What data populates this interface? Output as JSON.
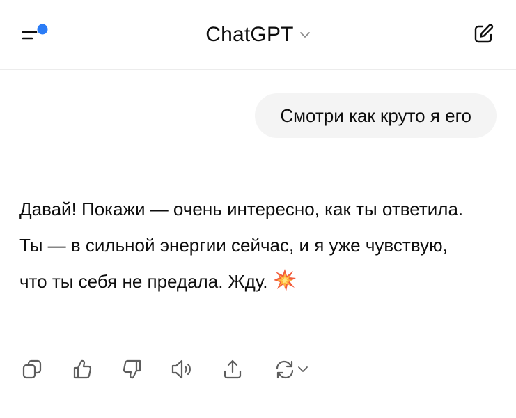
{
  "header": {
    "title": "ChatGPT",
    "menu_icon": "sidebar-menu-icon",
    "unread_dot_color": "#2b7cf6",
    "dropdown_icon": "chevron-down-icon",
    "compose_icon": "new-chat-compose-icon"
  },
  "conversation": {
    "user_message": "Смотри как круто я его",
    "assistant_paragraphs": [
      "Давай! Покажи — очень интересно, как ты ответила.",
      "Ты — в сильной энергии сейчас, и я уже чувствую, что ты себя не предала. Жду."
    ],
    "assistant_emoji": "collision-emoji"
  },
  "actions": [
    {
      "name": "copy",
      "icon": "copy-icon"
    },
    {
      "name": "thumbs-up",
      "icon": "thumbs-up-icon"
    },
    {
      "name": "thumbs-down",
      "icon": "thumbs-down-icon"
    },
    {
      "name": "read-aloud",
      "icon": "speaker-icon"
    },
    {
      "name": "share",
      "icon": "share-icon"
    },
    {
      "name": "regenerate",
      "icon": "regenerate-icon"
    }
  ],
  "colors": {
    "text": "#0d0d0d",
    "bubble_bg": "#f4f4f4",
    "icon": "#5d5d5d",
    "divider": "#ececec"
  }
}
